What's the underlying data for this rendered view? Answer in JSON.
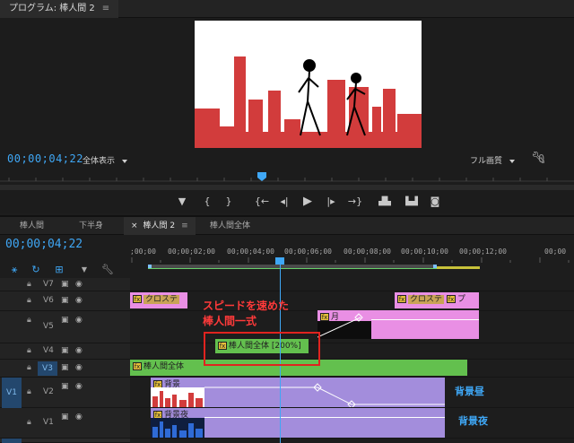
{
  "program_panel": {
    "tab_title": "プログラム: 棒人間 2",
    "menu_glyph": "≡",
    "timecode": "00;00;04;22",
    "fit_dropdown": "全体表示",
    "quality_dropdown": "フル画質",
    "settings_icon": "wrench-icon"
  },
  "transport": {
    "buttons": [
      {
        "name": "add-marker-button",
        "icon": "marker-icon",
        "glyph": "▼"
      },
      {
        "name": "mark-in-button",
        "icon": "mark-in-icon",
        "glyph": "{"
      },
      {
        "name": "mark-out-button",
        "icon": "mark-out-icon",
        "glyph": "}"
      },
      {
        "name": "go-to-in-button",
        "icon": "go-to-in-icon",
        "glyph": "{←"
      },
      {
        "name": "step-back-button",
        "icon": "step-back-icon",
        "glyph": "◂|"
      },
      {
        "name": "play-button",
        "icon": "play-icon",
        "glyph": "▶"
      },
      {
        "name": "step-forward-button",
        "icon": "step-forward-icon",
        "glyph": "|▸"
      },
      {
        "name": "go-to-out-button",
        "icon": "go-to-out-icon",
        "glyph": "→}"
      },
      {
        "name": "lift-button",
        "icon": "lift-icon",
        "glyph": "▟▙"
      },
      {
        "name": "extract-button",
        "icon": "extract-icon",
        "glyph": "▙▟"
      },
      {
        "name": "export-frame-button",
        "icon": "camera-icon",
        "glyph": "◙"
      }
    ]
  },
  "timeline_tabs": {
    "tabs": [
      "棒人間",
      "下半身",
      "棒人間 2",
      "棒人間全体"
    ],
    "active_index": 2,
    "close_glyph": "×",
    "menu_glyph": "≡"
  },
  "timeline": {
    "timecode": "00;00;04;22",
    "ruler_labels": [
      ";00;00",
      "00;00;02;00",
      "00;00;04;00",
      "00;00;06;00",
      "00;00;08;00",
      "00;00;10;00",
      "00;00;12;00",
      "00;00"
    ],
    "tools": [
      "snap-icon",
      "link-icon",
      "nest-icon",
      "marker-icon",
      "wrench-icon"
    ],
    "tracks": [
      {
        "name": "V7"
      },
      {
        "name": "V6"
      },
      {
        "name": "V5"
      },
      {
        "name": "V4"
      },
      {
        "name": "V3",
        "targeted": true
      },
      {
        "name": "V2",
        "source": "V1"
      },
      {
        "name": "V1"
      }
    ],
    "clips": {
      "v7_left": "クロステ",
      "v7_right": "クロステ",
      "v7_right_extra": "プ",
      "v5_moon": "月",
      "v4_speed": "棒人間全体 [200%]",
      "v3_nest": "棒人間全体",
      "v2_bg": "背景",
      "v1_bg": "背景夜"
    }
  },
  "annotations": {
    "red_line1": "スピードを速めた",
    "red_line2": "棒人間一式",
    "label_day": "背景昼",
    "label_night": "背景夜"
  },
  "colors": {
    "accent_blue": "#3fa7f5",
    "clip_pink": "#e98fe4",
    "clip_green": "#63c04e",
    "clip_purple": "#a38ddc",
    "annotation_red": "#ff3a3a"
  }
}
